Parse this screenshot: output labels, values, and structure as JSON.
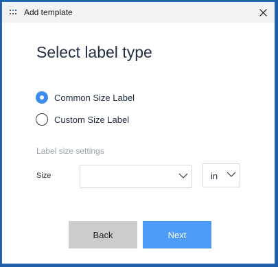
{
  "window": {
    "title": "Add template",
    "icon": "app-grid-icon",
    "close_icon": "close-icon"
  },
  "heading": "Select label type",
  "label_type": {
    "options": [
      {
        "label": "Common Size Label",
        "selected": true
      },
      {
        "label": "Custom Size Label",
        "selected": false
      }
    ]
  },
  "settings": {
    "section_label": "Label size settings",
    "size_label": "Size",
    "size_value": "",
    "unit_value": "in"
  },
  "buttons": {
    "back": "Back",
    "next": "Next"
  },
  "colors": {
    "accent": "#3d8cf0",
    "next_button": "#4d9cf8",
    "back_button": "#cccccc",
    "window_border": "#1f5fa8"
  }
}
